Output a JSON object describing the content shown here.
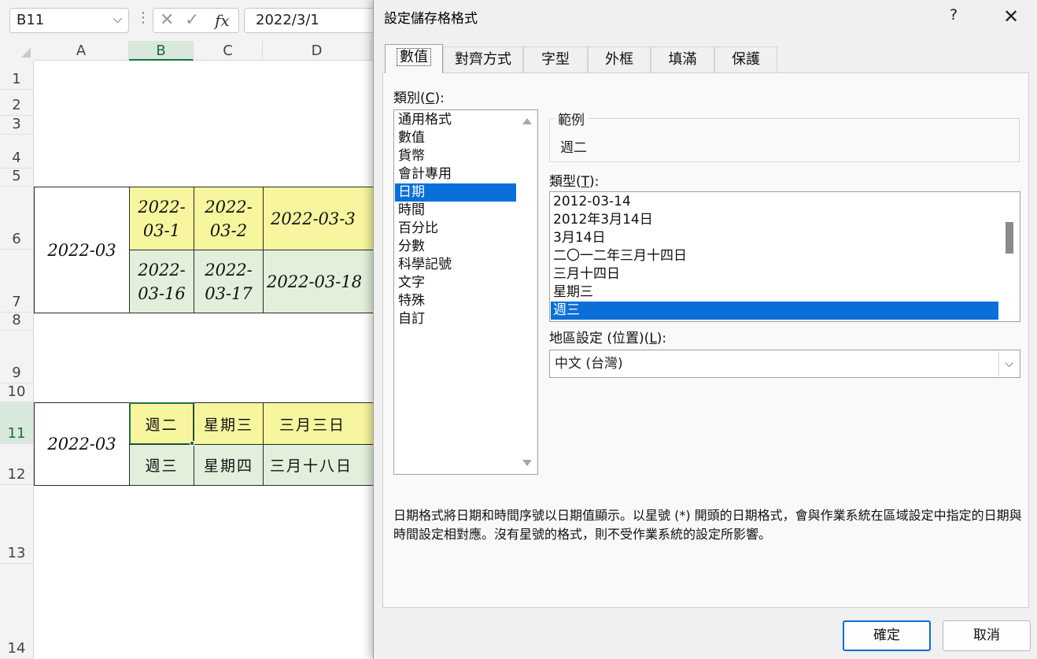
{
  "excel": {
    "name_box": "B11",
    "formula": "2022/3/1",
    "fx_label": "fx",
    "columns": [
      "A",
      "B",
      "C",
      "D"
    ],
    "rows": [
      "1",
      "2",
      "3",
      "4",
      "5",
      "6",
      "7",
      "8",
      "9",
      "10",
      "11",
      "12",
      "13",
      "14"
    ],
    "cells": {
      "a6": "2022-03",
      "b6": "2022-\n03-1",
      "c6": "2022-\n03-2",
      "d6": "2022-03-3",
      "b7": "2022-\n03-16",
      "c7": "2022-\n03-17",
      "d7": "2022-03-18",
      "a11": "2022-03",
      "b11": "週二",
      "c11": "星期三",
      "d11": "三月三日",
      "b12": "週三",
      "c12": "星期四",
      "d12": "三月十八日"
    }
  },
  "dialog": {
    "title": "設定儲存格格式",
    "help": "?",
    "close": "✕",
    "tabs": [
      "數值",
      "對齊方式",
      "字型",
      "外框",
      "填滿",
      "保護"
    ],
    "active_tab": "數值",
    "category_label_prefix": "類別(",
    "category_label_key": "C",
    "category_label_suffix": "):",
    "categories": [
      "通用格式",
      "數值",
      "貨幣",
      "會計專用",
      "日期",
      "時間",
      "百分比",
      "分數",
      "科學記號",
      "文字",
      "特殊",
      "自訂"
    ],
    "selected_category": "日期",
    "sample_label": "範例",
    "sample_value": "週二",
    "type_label_prefix": "類型(",
    "type_label_key": "T",
    "type_label_suffix": "):",
    "types": [
      "2012-03-14",
      "2012年3月14日",
      "3月14日",
      "二〇一二年三月十四日",
      "三月十四日",
      "星期三",
      "週三"
    ],
    "selected_type": "週三",
    "locale_label_prefix": "地區設定 (位置)(",
    "locale_label_key": "L",
    "locale_label_suffix": "):",
    "locale_value": "中文 (台灣)",
    "description": "日期格式將日期和時間序號以日期值顯示。以星號 (*) 開頭的日期格式，會與作業系統在區域設定中指定的日期與時間設定相對應。沒有星號的格式，則不受作業系統的設定所影響。",
    "ok_label": "確定",
    "cancel_label": "取消"
  },
  "colors": {
    "selection": "#0a6fd8",
    "yellow_fill": "#f7f59e",
    "green_fill": "#e2efda",
    "excel_accent": "#1e7145"
  }
}
